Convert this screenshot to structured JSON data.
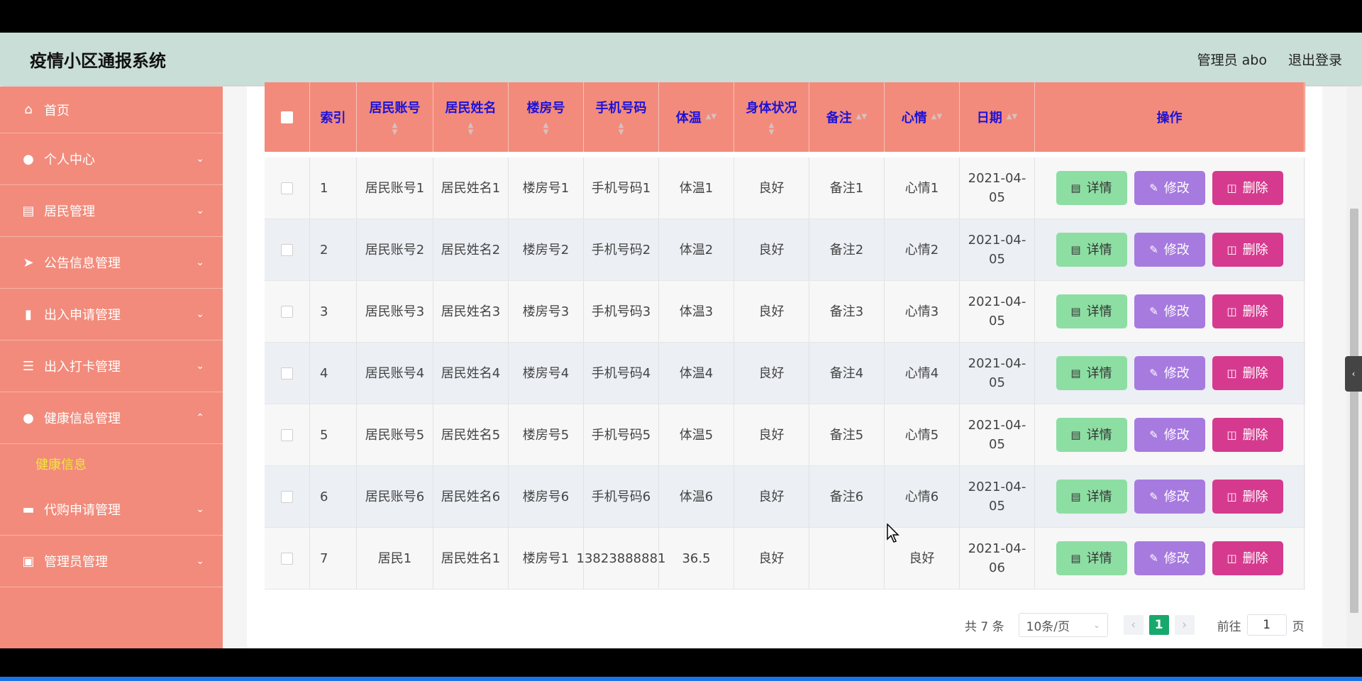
{
  "header": {
    "title": "疫情小区通报系统",
    "admin": "管理员 abo",
    "logout": "退出登录"
  },
  "sidebar": {
    "items": [
      {
        "label": "首页",
        "icon": "home-icon"
      },
      {
        "label": "个人中心",
        "icon": "user-icon"
      },
      {
        "label": "居民管理",
        "icon": "chat-icon"
      },
      {
        "label": "公告信息管理",
        "icon": "send-icon"
      },
      {
        "label": "出入申请管理",
        "icon": "clipboard-icon"
      },
      {
        "label": "出入打卡管理",
        "icon": "list-icon"
      },
      {
        "label": "健康信息管理",
        "icon": "bulb-icon"
      },
      {
        "label": "代购申请管理",
        "icon": "box-icon"
      },
      {
        "label": "管理员管理",
        "icon": "chart-icon"
      }
    ],
    "active_sub": "健康信息"
  },
  "table": {
    "headers": [
      "索引",
      "居民账号",
      "居民姓名",
      "楼房号",
      "手机号码",
      "体温",
      "身体状况",
      "备注",
      "心情",
      "日期",
      "操作"
    ],
    "rows": [
      {
        "idx": "1",
        "account": "居民账号1",
        "name": "居民姓名1",
        "building": "楼房号1",
        "phone": "手机号码1",
        "temp": "体温1",
        "health": "良好",
        "note": "备注1",
        "mood": "心情1",
        "date": "2021-04-05"
      },
      {
        "idx": "2",
        "account": "居民账号2",
        "name": "居民姓名2",
        "building": "楼房号2",
        "phone": "手机号码2",
        "temp": "体温2",
        "health": "良好",
        "note": "备注2",
        "mood": "心情2",
        "date": "2021-04-05"
      },
      {
        "idx": "3",
        "account": "居民账号3",
        "name": "居民姓名3",
        "building": "楼房号3",
        "phone": "手机号码3",
        "temp": "体温3",
        "health": "良好",
        "note": "备注3",
        "mood": "心情3",
        "date": "2021-04-05"
      },
      {
        "idx": "4",
        "account": "居民账号4",
        "name": "居民姓名4",
        "building": "楼房号4",
        "phone": "手机号码4",
        "temp": "体温4",
        "health": "良好",
        "note": "备注4",
        "mood": "心情4",
        "date": "2021-04-05"
      },
      {
        "idx": "5",
        "account": "居民账号5",
        "name": "居民姓名5",
        "building": "楼房号5",
        "phone": "手机号码5",
        "temp": "体温5",
        "health": "良好",
        "note": "备注5",
        "mood": "心情5",
        "date": "2021-04-05"
      },
      {
        "idx": "6",
        "account": "居民账号6",
        "name": "居民姓名6",
        "building": "楼房号6",
        "phone": "手机号码6",
        "temp": "体温6",
        "health": "良好",
        "note": "备注6",
        "mood": "心情6",
        "date": "2021-04-05"
      },
      {
        "idx": "7",
        "account": "居民1",
        "name": "居民姓名1",
        "building": "楼房号1",
        "phone": "13823888881",
        "temp": "36.5",
        "health": "良好",
        "note": "",
        "mood": "良好",
        "date": "2021-04-06"
      }
    ],
    "actions": {
      "detail": "详情",
      "edit": "修改",
      "delete": "删除"
    }
  },
  "pagination": {
    "total": "共 7 条",
    "page_size": "10条/页",
    "current": "1",
    "goto_label": "前往",
    "goto_value": "1",
    "page_suffix": "页"
  },
  "colors": {
    "sidebar": "#f28b7b",
    "header": "#c9ded6",
    "header_text": "#1d12d9",
    "detail": "#8ddea3",
    "edit": "#a77ae0",
    "delete": "#d63a8f"
  }
}
